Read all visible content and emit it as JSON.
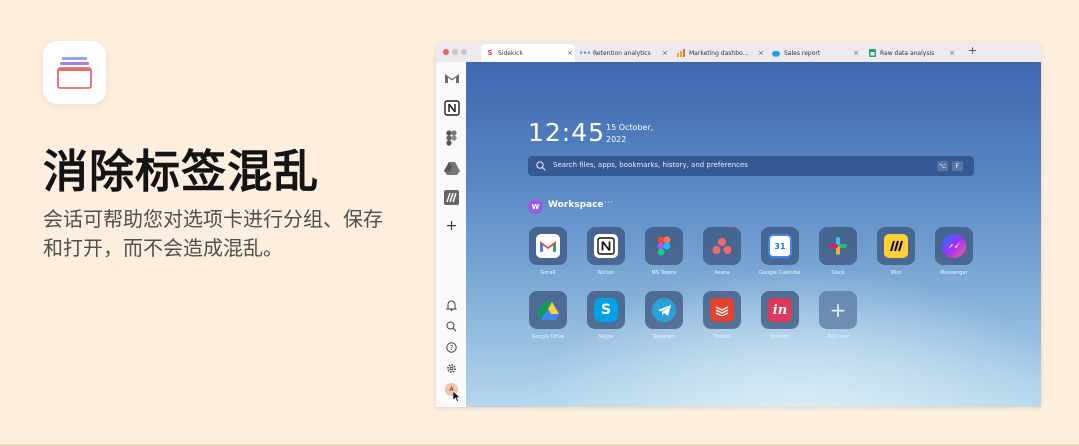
{
  "promo": {
    "headline": "消除标签混乱",
    "description": "会话可帮助您对选项卡进行分组、保存和打开，而不会造成混乱。"
  },
  "browser": {
    "tabs": [
      {
        "label": "Sidekick",
        "icon": "sidekick-logo",
        "active": true
      },
      {
        "label": "Retention analytics",
        "icon": "dots-icon",
        "active": false
      },
      {
        "label": "Marketing dashbo...",
        "icon": "bar-chart-icon",
        "active": false
      },
      {
        "label": "Sales report",
        "icon": "salesforce-cloud-icon",
        "active": false
      },
      {
        "label": "Raw data analysis",
        "icon": "sheets-icon",
        "active": false
      }
    ],
    "tab_close": "×",
    "new_tab": "+",
    "sidebar": {
      "apps": [
        "gmail-icon",
        "notion-icon",
        "figma-icon",
        "google-drive-icon",
        "miro-icon"
      ],
      "add": "+",
      "bottom": [
        "bell-icon",
        "search-icon",
        "help-icon",
        "settings-icon"
      ],
      "avatar": "A"
    }
  },
  "newtab": {
    "time": "12:45",
    "date": "15 October, 2022",
    "search_placeholder": "Search files, apps, bookmarks, history, and preferences",
    "shortcut_keys": [
      "⌥",
      "F"
    ],
    "workspace_initial": "W",
    "workspace_label": "Workspace",
    "workspace_more": "···",
    "apps": [
      {
        "label": "Gmail"
      },
      {
        "label": "Notion"
      },
      {
        "label": "MS Teams"
      },
      {
        "label": "Asana"
      },
      {
        "label": "Google Calendar"
      },
      {
        "label": "Slack"
      },
      {
        "label": "Miro"
      },
      {
        "label": "Messenger"
      },
      {
        "label": "Google Drive"
      },
      {
        "label": "Skype"
      },
      {
        "label": "Telegram"
      },
      {
        "label": "Todoist"
      },
      {
        "label": "Invision"
      },
      {
        "label": "Add new"
      }
    ],
    "calendar_day": "31"
  },
  "colors": {
    "page_bg": "#fdeede",
    "accent_workspace": "#9a5ce0",
    "sidekick_red": "#e8453c"
  }
}
